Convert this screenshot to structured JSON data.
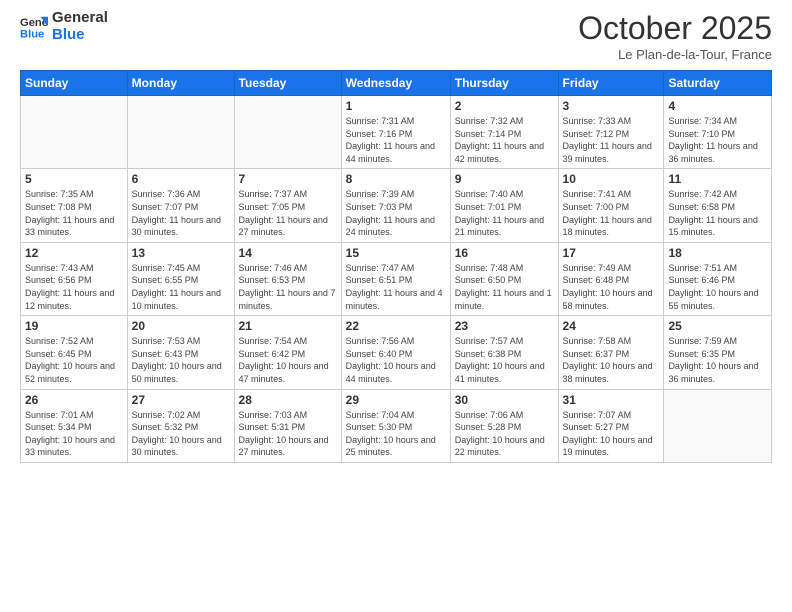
{
  "header": {
    "logo_line1": "General",
    "logo_line2": "Blue",
    "month_title": "October 2025",
    "subtitle": "Le Plan-de-la-Tour, France"
  },
  "days_of_week": [
    "Sunday",
    "Monday",
    "Tuesday",
    "Wednesday",
    "Thursday",
    "Friday",
    "Saturday"
  ],
  "weeks": [
    [
      {
        "day": "",
        "info": ""
      },
      {
        "day": "",
        "info": ""
      },
      {
        "day": "",
        "info": ""
      },
      {
        "day": "1",
        "info": "Sunrise: 7:31 AM\nSunset: 7:16 PM\nDaylight: 11 hours and 44 minutes."
      },
      {
        "day": "2",
        "info": "Sunrise: 7:32 AM\nSunset: 7:14 PM\nDaylight: 11 hours and 42 minutes."
      },
      {
        "day": "3",
        "info": "Sunrise: 7:33 AM\nSunset: 7:12 PM\nDaylight: 11 hours and 39 minutes."
      },
      {
        "day": "4",
        "info": "Sunrise: 7:34 AM\nSunset: 7:10 PM\nDaylight: 11 hours and 36 minutes."
      }
    ],
    [
      {
        "day": "5",
        "info": "Sunrise: 7:35 AM\nSunset: 7:08 PM\nDaylight: 11 hours and 33 minutes."
      },
      {
        "day": "6",
        "info": "Sunrise: 7:36 AM\nSunset: 7:07 PM\nDaylight: 11 hours and 30 minutes."
      },
      {
        "day": "7",
        "info": "Sunrise: 7:37 AM\nSunset: 7:05 PM\nDaylight: 11 hours and 27 minutes."
      },
      {
        "day": "8",
        "info": "Sunrise: 7:39 AM\nSunset: 7:03 PM\nDaylight: 11 hours and 24 minutes."
      },
      {
        "day": "9",
        "info": "Sunrise: 7:40 AM\nSunset: 7:01 PM\nDaylight: 11 hours and 21 minutes."
      },
      {
        "day": "10",
        "info": "Sunrise: 7:41 AM\nSunset: 7:00 PM\nDaylight: 11 hours and 18 minutes."
      },
      {
        "day": "11",
        "info": "Sunrise: 7:42 AM\nSunset: 6:58 PM\nDaylight: 11 hours and 15 minutes."
      }
    ],
    [
      {
        "day": "12",
        "info": "Sunrise: 7:43 AM\nSunset: 6:56 PM\nDaylight: 11 hours and 12 minutes."
      },
      {
        "day": "13",
        "info": "Sunrise: 7:45 AM\nSunset: 6:55 PM\nDaylight: 11 hours and 10 minutes."
      },
      {
        "day": "14",
        "info": "Sunrise: 7:46 AM\nSunset: 6:53 PM\nDaylight: 11 hours and 7 minutes."
      },
      {
        "day": "15",
        "info": "Sunrise: 7:47 AM\nSunset: 6:51 PM\nDaylight: 11 hours and 4 minutes."
      },
      {
        "day": "16",
        "info": "Sunrise: 7:48 AM\nSunset: 6:50 PM\nDaylight: 11 hours and 1 minute."
      },
      {
        "day": "17",
        "info": "Sunrise: 7:49 AM\nSunset: 6:48 PM\nDaylight: 10 hours and 58 minutes."
      },
      {
        "day": "18",
        "info": "Sunrise: 7:51 AM\nSunset: 6:46 PM\nDaylight: 10 hours and 55 minutes."
      }
    ],
    [
      {
        "day": "19",
        "info": "Sunrise: 7:52 AM\nSunset: 6:45 PM\nDaylight: 10 hours and 52 minutes."
      },
      {
        "day": "20",
        "info": "Sunrise: 7:53 AM\nSunset: 6:43 PM\nDaylight: 10 hours and 50 minutes."
      },
      {
        "day": "21",
        "info": "Sunrise: 7:54 AM\nSunset: 6:42 PM\nDaylight: 10 hours and 47 minutes."
      },
      {
        "day": "22",
        "info": "Sunrise: 7:56 AM\nSunset: 6:40 PM\nDaylight: 10 hours and 44 minutes."
      },
      {
        "day": "23",
        "info": "Sunrise: 7:57 AM\nSunset: 6:38 PM\nDaylight: 10 hours and 41 minutes."
      },
      {
        "day": "24",
        "info": "Sunrise: 7:58 AM\nSunset: 6:37 PM\nDaylight: 10 hours and 38 minutes."
      },
      {
        "day": "25",
        "info": "Sunrise: 7:59 AM\nSunset: 6:35 PM\nDaylight: 10 hours and 36 minutes."
      }
    ],
    [
      {
        "day": "26",
        "info": "Sunrise: 7:01 AM\nSunset: 5:34 PM\nDaylight: 10 hours and 33 minutes."
      },
      {
        "day": "27",
        "info": "Sunrise: 7:02 AM\nSunset: 5:32 PM\nDaylight: 10 hours and 30 minutes."
      },
      {
        "day": "28",
        "info": "Sunrise: 7:03 AM\nSunset: 5:31 PM\nDaylight: 10 hours and 27 minutes."
      },
      {
        "day": "29",
        "info": "Sunrise: 7:04 AM\nSunset: 5:30 PM\nDaylight: 10 hours and 25 minutes."
      },
      {
        "day": "30",
        "info": "Sunrise: 7:06 AM\nSunset: 5:28 PM\nDaylight: 10 hours and 22 minutes."
      },
      {
        "day": "31",
        "info": "Sunrise: 7:07 AM\nSunset: 5:27 PM\nDaylight: 10 hours and 19 minutes."
      },
      {
        "day": "",
        "info": ""
      }
    ]
  ]
}
